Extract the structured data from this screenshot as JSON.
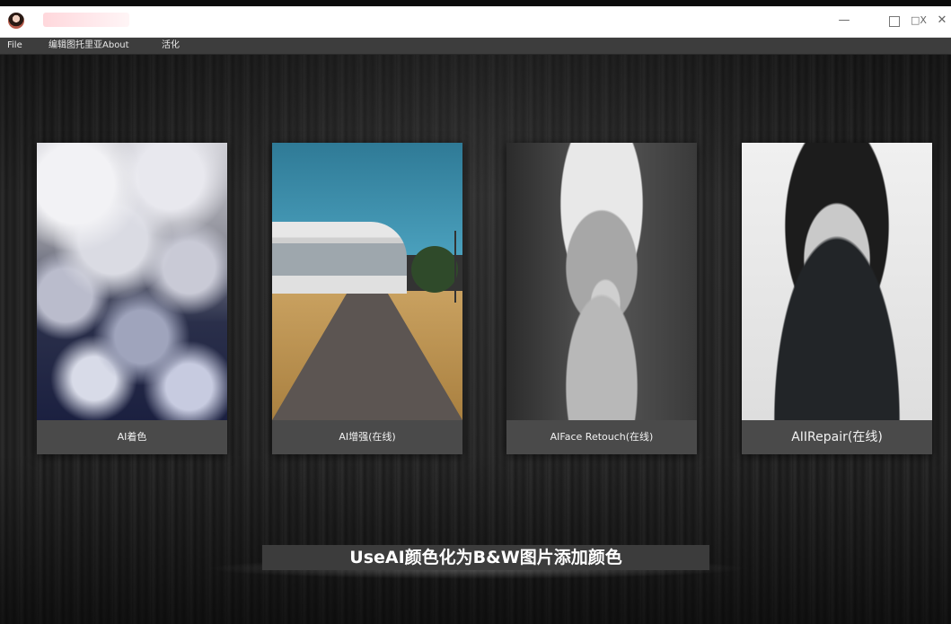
{
  "window": {
    "title": "",
    "controls": {
      "minimize": "—",
      "maximize": "",
      "restore": "□X",
      "close": "✕"
    }
  },
  "menu": {
    "file": "File",
    "edit": "编辑图托里亚About",
    "activate": "活化"
  },
  "cards": [
    {
      "label": "AI着色",
      "image": "clouds"
    },
    {
      "label": "AI增强(在线)",
      "image": "building-road"
    },
    {
      "label": "AIFace Retouch(在线)",
      "image": "old-man-portrait"
    },
    {
      "label": "AIIRepair(在线)",
      "image": "woman-portrait"
    }
  ],
  "caption": "UseAI颜色化为B&W图片添加颜色",
  "colors": {
    "titlebar": "#ffffff",
    "menubar": "#3d3d3d",
    "card_label_bg": "#4a4a4a",
    "caption_bg": "#3c3c3c"
  }
}
